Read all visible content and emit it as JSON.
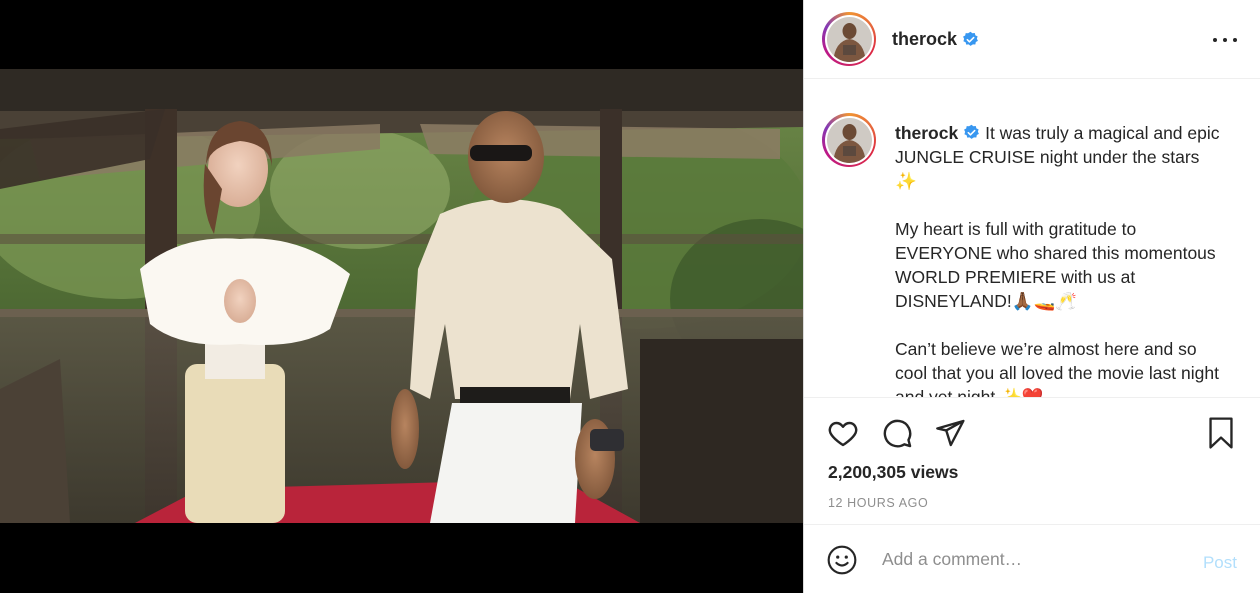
{
  "post": {
    "username": "therock",
    "verified": true,
    "caption": {
      "username": "therock",
      "text": " It was truly a magical and epic JUNGLE CRUISE night under the stars ✨\n\nMy heart is full with gratitude to EVERYONE who shared this momentous WORLD PREMIERE with us at DISNEYLAND!🙏🏾🚤🥂\n\nCan’t believe we’re almost here and so cool that you all loved the movie last night and yet night ✨❤️"
    },
    "views": "2,200,305 views",
    "time_ago": "12 HOURS AGO"
  },
  "icons": {
    "more": "more-options-icon",
    "like": "heart-icon",
    "comment": "comment-icon",
    "share": "paper-plane-icon",
    "save": "bookmark-icon",
    "emoji": "smiley-icon",
    "mute": "muted-speaker-icon",
    "verified": "verified-badge-icon"
  },
  "comment_box": {
    "placeholder": "Add a comment…",
    "post_label": "Post"
  },
  "colors": {
    "verified_blue": "#3897f0",
    "post_button_disabled": "#b2dffc",
    "secondary_text": "#8e8e8e",
    "divider": "#efefef"
  }
}
